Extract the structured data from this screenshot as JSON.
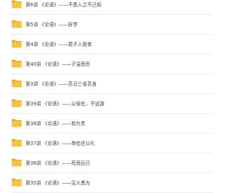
{
  "file_list": {
    "items": [
      {
        "name": "第6讲 《论语》——不患人之不己知",
        "icon": "folder-icon"
      },
      {
        "name": "第5讲 《论语》——好学",
        "icon": "folder-icon"
      },
      {
        "name": "第4讲 《论语》——君子入则孝",
        "icon": "folder-icon"
      },
      {
        "name": "第40讲 《论语》——子温而厉",
        "icon": "folder-icon"
      },
      {
        "name": "第3讲 《论语》——吾日三省吾身",
        "icon": "folder-icon"
      },
      {
        "name": "第39讲 《论语》——父母在，不远游",
        "icon": "folder-icon"
      },
      {
        "name": "第38讲 《论语》——和为贵",
        "icon": "folder-icon"
      },
      {
        "name": "第37讲 《论语》——恭俭庄以礼",
        "icon": "folder-icon"
      },
      {
        "name": "第36讲 《论语》——死而后已",
        "icon": "folder-icon"
      },
      {
        "name": "第35讲 《论语》——见义勇为",
        "icon": "folder-icon"
      }
    ]
  },
  "colors": {
    "folder_body": "#f5c242",
    "folder_tab": "#e9a921",
    "text": "#3a3a3a",
    "divider": "#eceef2"
  }
}
